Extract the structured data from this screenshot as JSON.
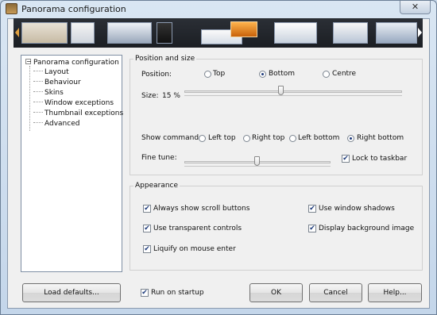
{
  "window": {
    "title": "Panorama configuration",
    "close_glyph": "✕"
  },
  "tree": {
    "root": "Panorama configuration",
    "items": [
      "Layout",
      "Behaviour",
      "Skins",
      "Window exceptions",
      "Thumbnail exceptions",
      "Advanced"
    ]
  },
  "position_size": {
    "title": "Position and size",
    "position_label": "Position:",
    "position_options": [
      "Top",
      "Bottom",
      "Centre"
    ],
    "position_selected": "Bottom",
    "size_label": "Size:",
    "size_value": "15 %",
    "show_command_label": "Show command:",
    "show_command_options": [
      "Left top",
      "Right top",
      "Left bottom",
      "Right bottom"
    ],
    "show_command_selected": "Right bottom",
    "fine_tune_label": "Fine tune:",
    "lock_label": "Lock to taskbar",
    "lock_checked": true
  },
  "appearance": {
    "title": "Appearance",
    "options": [
      {
        "label": "Always show scroll buttons",
        "checked": true
      },
      {
        "label": "Use window shadows",
        "checked": true
      },
      {
        "label": "Use transparent controls",
        "checked": true
      },
      {
        "label": "Display background image",
        "checked": true
      },
      {
        "label": "Liquify on mouse enter",
        "checked": true
      }
    ]
  },
  "footer": {
    "load_defaults": "Load defaults...",
    "run_on_startup": "Run on startup",
    "run_on_startup_checked": true,
    "ok": "OK",
    "cancel": "Cancel",
    "help": "Help..."
  },
  "icons": {
    "check_glyph": "✔"
  }
}
